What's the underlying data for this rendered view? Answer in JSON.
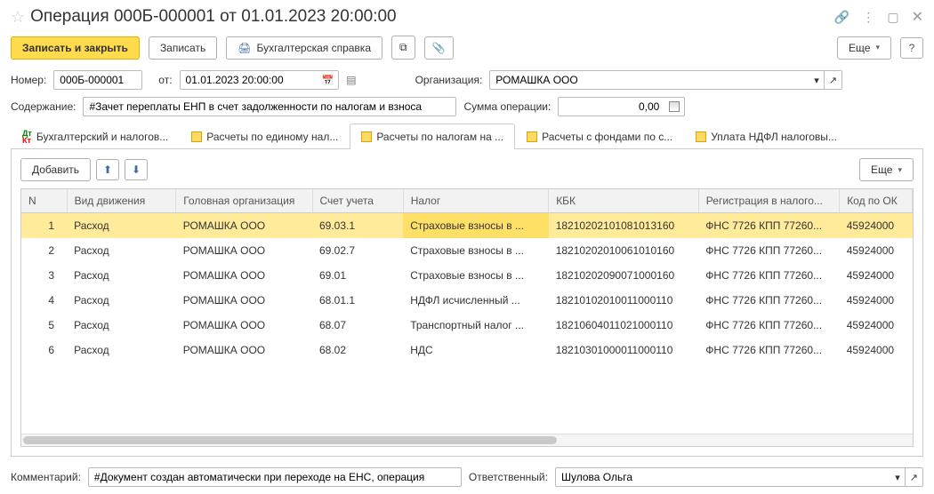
{
  "title": "Операция 000Б-000001 от 01.01.2023 20:00:00",
  "toolbar": {
    "save_close": "Записать и закрыть",
    "save": "Записать",
    "report": "Бухгалтерская справка",
    "more": "Еще"
  },
  "header": {
    "number_label": "Номер:",
    "number_value": "000Б-000001",
    "date_label": "от:",
    "date_value": "01.01.2023 20:00:00",
    "org_label": "Организация:",
    "org_value": "РОМАШКА ООО",
    "content_label": "Содержание:",
    "content_value": "#Зачет переплаты ЕНП в счет задолженности по налогам и взноса",
    "sum_label": "Сумма операции:",
    "sum_value": "0,00"
  },
  "tabs": [
    {
      "label": "Бухгалтерский и налогов...",
      "type": "dk"
    },
    {
      "label": "Расчеты по единому нал...",
      "type": "y"
    },
    {
      "label": "Расчеты по налогам на ...",
      "type": "y",
      "active": true
    },
    {
      "label": "Расчеты с фондами по с...",
      "type": "y"
    },
    {
      "label": "Уплата НДФЛ налоговы...",
      "type": "y"
    }
  ],
  "panel": {
    "add": "Добавить",
    "more": "Еще"
  },
  "table": {
    "headers": {
      "n": "N",
      "vid": "Вид движения",
      "org": "Головная организация",
      "acct": "Счет учета",
      "nalog": "Налог",
      "kbk": "КБК",
      "reg": "Регистрация в налого...",
      "kod": "Код по ОК"
    },
    "rows": [
      {
        "n": "1",
        "vid": "Расход",
        "org": "РОМАШКА ООО",
        "acct": "69.03.1",
        "nalog": "Страховые взносы в ...",
        "kbk": "18210202101081013160",
        "reg": "ФНС 7726 КПП 77260...",
        "kod": "45924000",
        "selected": true
      },
      {
        "n": "2",
        "vid": "Расход",
        "org": "РОМАШКА ООО",
        "acct": "69.02.7",
        "nalog": "Страховые взносы в ...",
        "kbk": "18210202010061010160",
        "reg": "ФНС 7726 КПП 77260...",
        "kod": "45924000"
      },
      {
        "n": "3",
        "vid": "Расход",
        "org": "РОМАШКА ООО",
        "acct": "69.01",
        "nalog": "Страховые взносы в ...",
        "kbk": "18210202090071000160",
        "reg": "ФНС 7726 КПП 77260...",
        "kod": "45924000"
      },
      {
        "n": "4",
        "vid": "Расход",
        "org": "РОМАШКА ООО",
        "acct": "68.01.1",
        "nalog": "НДФЛ исчисленный ...",
        "kbk": "18210102010011000110",
        "reg": "ФНС 7726 КПП 77260...",
        "kod": "45924000"
      },
      {
        "n": "5",
        "vid": "Расход",
        "org": "РОМАШКА ООО",
        "acct": "68.07",
        "nalog": "Транспортный налог ...",
        "kbk": "18210604011021000110",
        "reg": "ФНС 7726 КПП 77260...",
        "kod": "45924000"
      },
      {
        "n": "6",
        "vid": "Расход",
        "org": "РОМАШКА ООО",
        "acct": "68.02",
        "nalog": "НДС",
        "kbk": "18210301000011000110",
        "reg": "ФНС 7726 КПП 77260...",
        "kod": "45924000"
      }
    ]
  },
  "footer": {
    "comment_label": "Комментарий:",
    "comment_value": "#Документ создан автоматически при переходе на ЕНС, операция",
    "resp_label": "Ответственный:",
    "resp_value": "Шулова Ольга"
  }
}
